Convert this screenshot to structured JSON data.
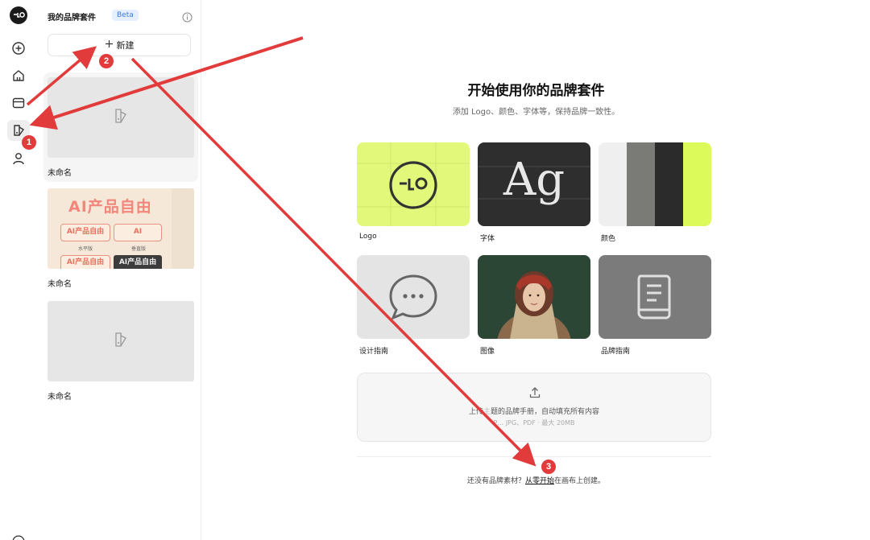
{
  "panel": {
    "title": "我的品牌套件",
    "badge": "Beta",
    "new_label": "新建",
    "kits": [
      {
        "name": "未命名"
      },
      {
        "name": "未命名"
      },
      {
        "name": "未命名"
      }
    ]
  },
  "ai_thumb": {
    "big": "AI产品自由",
    "box1": "AI产品自由",
    "box2": "AI",
    "box3": "AI产品自由",
    "box4": "AI产品自由",
    "tag1": "水平版",
    "tag2": "垂直版"
  },
  "main": {
    "title": "开始使用你的品牌套件",
    "subtitle": "添加 Logo、颜色、字体等，保持品牌一致性。",
    "cards": [
      {
        "label": "Logo"
      },
      {
        "label": "字体"
      },
      {
        "label": "颜色"
      },
      {
        "label": "设计指南"
      },
      {
        "label": "图像"
      },
      {
        "label": "品牌指南"
      }
    ],
    "font_sample": "Ag",
    "upload_main_left": "上传",
    "upload_main_right": "题的品牌手册，自动填充所有内容",
    "upload_sub": "P… JPG、PDF · 最大 20MB",
    "footer_prefix": "还没有品牌素材？",
    "footer_link": "从零开始",
    "footer_suffix": "在画布上创建。"
  },
  "annotations": [
    "1",
    "2",
    "3"
  ],
  "colors": {
    "lime": "#e1f87a",
    "dark": "#2e2e2e",
    "gray_card": "#7b7b7b",
    "accent_red": "#e23b3b"
  }
}
